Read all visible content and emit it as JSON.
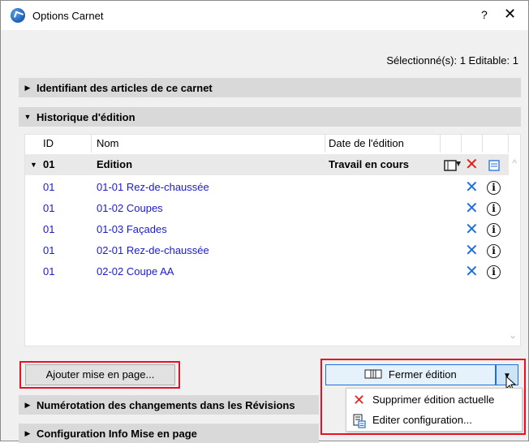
{
  "window": {
    "title": "Options Carnet",
    "help": "?",
    "close": "✕"
  },
  "selection_info": "Sélectionné(s): 1 Editable: 1",
  "sections": {
    "identifiant": "Identifiant des articles de ce carnet",
    "historique": "Historique d'édition",
    "numerotation": "Numérotation des changements dans les Révisions",
    "configuration": "Configuration Info Mise en page"
  },
  "table": {
    "headers": {
      "id": "ID",
      "nom": "Nom",
      "date": "Date de l'édition"
    },
    "group": {
      "id": "01",
      "nom": "Edition",
      "date": "Travail en cours"
    },
    "rows": [
      {
        "id": "01",
        "nom": "01-01 Rez-de-chaussée"
      },
      {
        "id": "01",
        "nom": "01-02 Coupes"
      },
      {
        "id": "01",
        "nom": "01-03 Façades"
      },
      {
        "id": "01",
        "nom": "02-01 Rez-de-chaussée"
      },
      {
        "id": "01",
        "nom": "02-02 Coupe AA"
      }
    ]
  },
  "buttons": {
    "add_layout": "Ajouter mise en page...",
    "close_edition": "Fermer édition"
  },
  "menu": {
    "delete": "Supprimer édition actuelle",
    "edit_config": "Editer configuration..."
  },
  "colors": {
    "link": "#1a1ad6",
    "highlight_box": "#e81123",
    "delete_red": "#e0201a",
    "action_blue": "#1e6fdc"
  }
}
